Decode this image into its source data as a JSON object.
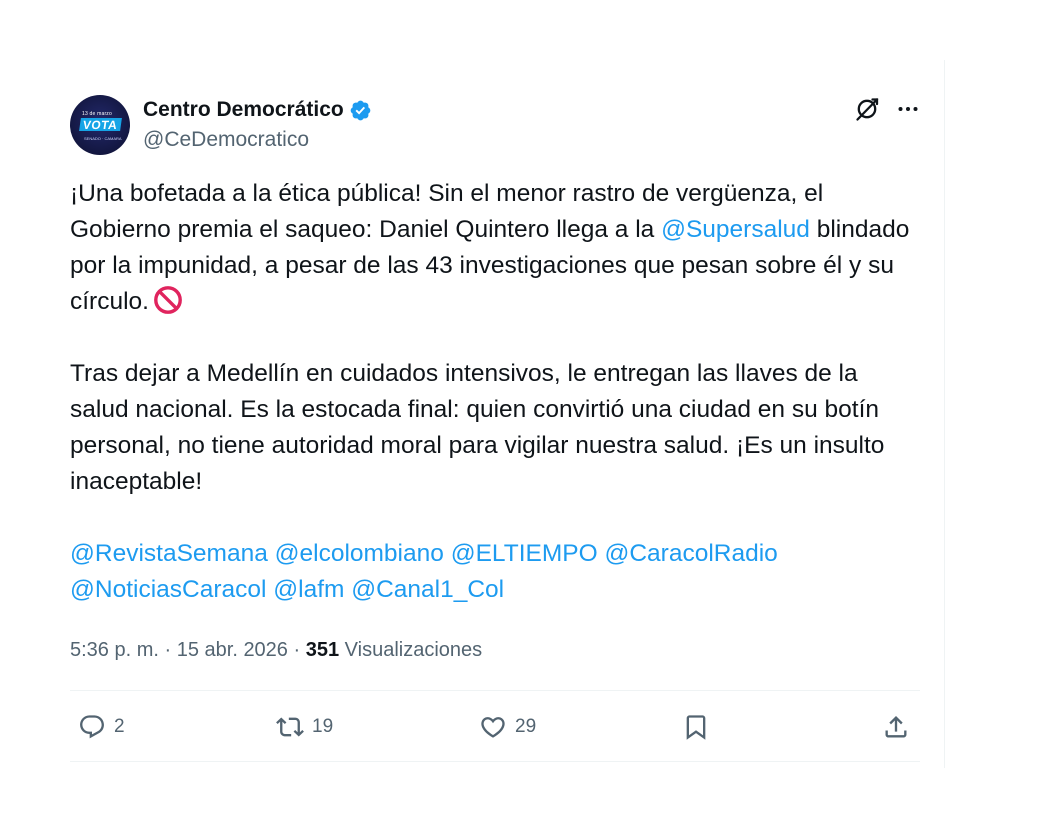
{
  "author": {
    "display_name": "Centro Democrático",
    "handle": "@CeDemocratico",
    "verified": true,
    "avatar": {
      "top_text": "13 de marzo",
      "main_text": "VOTA",
      "bottom_text": "SENADO · CAMARA",
      "bg_color": "#141843",
      "accent_color": "#16a4e6"
    }
  },
  "header_icons": {
    "grok": "grok-icon",
    "more": "more-icon"
  },
  "tweet": {
    "p1": {
      "t1": "¡Una bofetada a la ética pública! Sin el menor rastro de vergüenza, el Gobierno premia el saqueo: Daniel Quintero llega a la ",
      "mention": "@Supersalud",
      "t2": " blindado por la impunidad, a pesar de las 43 investigaciones que pesan sobre él y su círculo.",
      "emoji": "no-entry-sign-icon"
    },
    "p2": "Tras dejar a Medellín en cuidados intensivos, le entregan las llaves de la salud nacional. Es la estocada final: quien convirtió una ciudad en su botín personal, no tiene autoridad moral para vigilar nuestra salud. ¡Es un insulto inaceptable!",
    "mentions": [
      "@RevistaSemana",
      "@elcolombiano",
      "@ELTIEMPO",
      "@CaracolRadio",
      "@NoticiasCaracol",
      "@lafm",
      "@Canal1_Col"
    ]
  },
  "meta": {
    "time": "5:36 p. m.",
    "sep": " · ",
    "date": "15 abr. 2026",
    "views_count": "351",
    "views_label": "Visualizaciones"
  },
  "actions": {
    "replies": "2",
    "reposts": "19",
    "likes": "29"
  },
  "colors": {
    "accent": "#1d9bf0",
    "text": "#0f1419",
    "muted": "#536471",
    "divider": "#eff3f4"
  }
}
